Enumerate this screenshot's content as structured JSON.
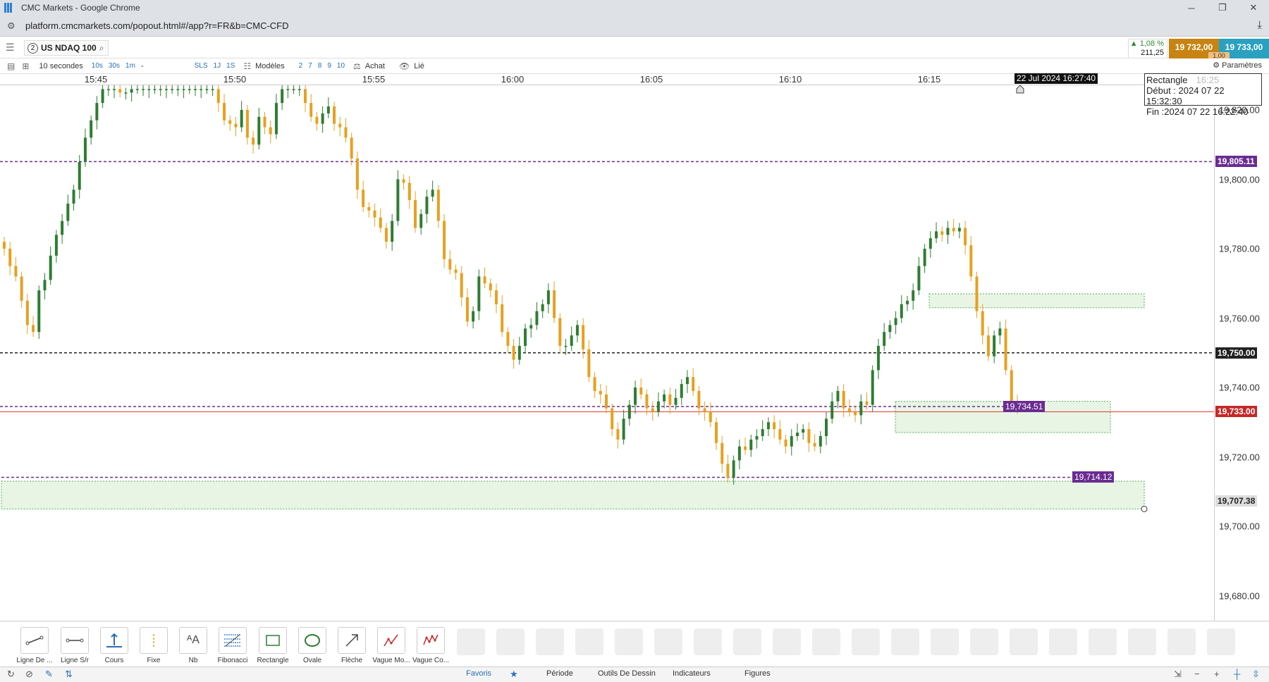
{
  "window": {
    "title": "CMC Markets - Google Chrome",
    "minimize": "─",
    "restore": "❐",
    "close": "✕"
  },
  "address": {
    "url": "platform.cmcmarkets.com/popout.html#/app?r=FR&b=CMC-CFD"
  },
  "instrument": {
    "number": "2",
    "name": "US NDAQ 100"
  },
  "quote": {
    "change_pct": "▲ 1,08 %",
    "change_abs": "211,25",
    "sell": "19 732,00",
    "buy": "19 733,00",
    "qty": "1,00"
  },
  "toolbar": {
    "interval": "10 secondes",
    "quick_intervals": [
      "10s",
      "30s",
      "1m",
      "-"
    ],
    "range_buttons": [
      "SLS",
      "1J",
      "1S"
    ],
    "templates": "Modèles",
    "num_buttons": [
      "2",
      "7",
      "8",
      "9",
      "10"
    ],
    "buy_label": "Achat",
    "linked_label": "Lié",
    "settings_label": "Paramètres"
  },
  "time_axis": {
    "labels": [
      "15:45",
      "15:50",
      "15:55",
      "16:00",
      "16:05",
      "16:10",
      "16:15"
    ],
    "cursor_label": "22 Jul 2024 16:27:40"
  },
  "info_box": {
    "title": "Rectangle",
    "faint_time": "16:25",
    "start": "Début : 2024 07 22 15:32:30",
    "end": "Fin :2024 07 22 16:22:40"
  },
  "price_axis": {
    "labels": [
      "19,820.00",
      "19,800.00",
      "19,780.00",
      "19,760.00",
      "19,740.00",
      "19,720.00",
      "19,700.00",
      "19,680.00"
    ]
  },
  "price_tags": {
    "level_high": "19,805.11",
    "level_mid": "19,750.00",
    "current": "19,733.00",
    "rect_low": "19,707.38",
    "inline_a": "19,734.51",
    "inline_b": "19,714.12"
  },
  "colors": {
    "up": "#2e7d32",
    "down": "#e8a020",
    "current_line": "#e53935",
    "purple": "#6a2c91",
    "zone_fill": "#e8f5e5",
    "zone_border": "#4caf50"
  },
  "chart_data": {
    "type": "candlestick",
    "instrument": "US NDAQ 100",
    "interval": "10 secondes",
    "x_ticks": [
      "15:45",
      "15:50",
      "15:55",
      "16:00",
      "16:05",
      "16:10",
      "16:15"
    ],
    "y_ticks": [
      19820,
      19800,
      19780,
      19760,
      19740,
      19720,
      19700,
      19680
    ],
    "ylim": [
      19672,
      19826
    ],
    "close_path": [
      19780,
      19775,
      19772,
      19765,
      19758,
      19756,
      19768,
      19771,
      19778,
      19784,
      19788,
      19793,
      19797,
      19805,
      19812,
      19817,
      19822,
      19826,
      19826,
      19826,
      19825,
      19825,
      19826,
      19826,
      19826,
      19826,
      19826,
      19826,
      19826,
      19826,
      19826,
      19826,
      19826,
      19826,
      19826,
      19826,
      19826,
      19822,
      19817,
      19816,
      19815,
      19820,
      19812,
      19810,
      19818,
      19815,
      19813,
      19822,
      19826,
      19826,
      19826,
      19826,
      19822,
      19818,
      19816,
      19819,
      19821,
      19816,
      19815,
      19812,
      19806,
      19797,
      19792,
      19791,
      19789,
      19786,
      19782,
      19788,
      19800,
      19799,
      19794,
      19786,
      19790,
      19795,
      19797,
      19788,
      19777,
      19774,
      19773,
      19766,
      19759,
      19762,
      19772,
      19770,
      19768,
      19764,
      19756,
      19752,
      19748,
      19752,
      19757,
      19758,
      19762,
      19764,
      19768,
      19760,
      19752,
      19752,
      19755,
      19758,
      19751,
      19743,
      19739,
      19738,
      19734,
      19728,
      19725,
      19731,
      19735,
      19740,
      19738,
      19734,
      19733,
      19736,
      19738,
      19735,
      19737,
      19741,
      19743,
      19739,
      19734,
      19733,
      19730,
      19724,
      19718,
      19714,
      19719,
      19723,
      19722,
      19725,
      19726,
      19728,
      19730,
      19728,
      19725,
      19723,
      19726,
      19727,
      19728,
      19724,
      19723,
      19726,
      19731,
      19736,
      19739,
      19734,
      19733,
      19732,
      19736,
      19735,
      19745,
      19752,
      19756,
      19758,
      19760,
      19764,
      19765,
      19768,
      19775,
      19780,
      19783,
      19785,
      19784,
      19786,
      19785,
      19786,
      19781,
      19772,
      19762,
      19755,
      19749,
      19755,
      19757,
      19745,
      19736,
      19735
    ],
    "horizontal_levels": [
      19805.11,
      19750.0,
      19733.0,
      19734.51
    ],
    "zones": [
      {
        "top": 19767,
        "bottom": 19763
      },
      {
        "top": 19736,
        "bottom": 19727
      },
      {
        "top": 19713,
        "bottom": 19705
      }
    ]
  },
  "drawing_tools": [
    "Ligne De ...",
    "Ligne S/r",
    "Cours",
    "Fixe",
    "Nb",
    "Fibonacci",
    "Rectangle",
    "Ovale",
    "Flèche",
    "Vague Mo...",
    "Vague Co..."
  ],
  "bottom_tabs": [
    "Favoris",
    "Période",
    "Outils De Dessin",
    "Indicateurs",
    "Figures"
  ]
}
